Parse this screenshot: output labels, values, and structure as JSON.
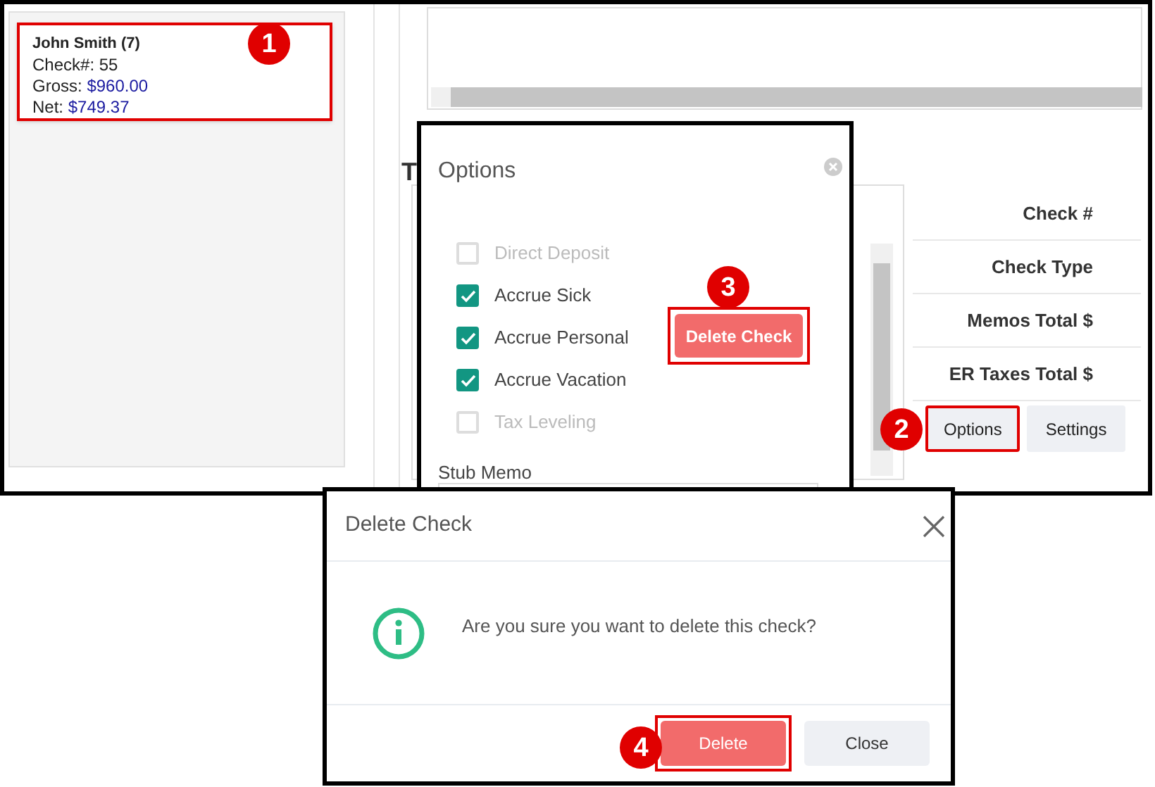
{
  "employee_card": {
    "name": "John Smith (7)",
    "check_no": "Check#: 55",
    "gross_label": "Gross:",
    "gross_value": "$960.00",
    "net_label": "Net:",
    "net_value": "$749.37",
    "highlighted": true,
    "callout": "1"
  },
  "section_heading": "T",
  "summary_labels": [
    "Check #",
    "Check Type",
    "Memos Total $",
    "ER Taxes Total $"
  ],
  "buttons": [
    {
      "label": "Options",
      "highlighted": true,
      "callout": "2"
    },
    {
      "label": "Settings",
      "highlighted": false
    }
  ],
  "options_popup": {
    "title": "Options",
    "checkboxes": [
      {
        "label": "Direct Deposit",
        "checked": false,
        "disabled": true
      },
      {
        "label": "Accrue Sick",
        "checked": true,
        "disabled": false
      },
      {
        "label": "Accrue Personal",
        "checked": true,
        "disabled": false
      },
      {
        "label": "Accrue Vacation",
        "checked": true,
        "disabled": false
      },
      {
        "label": "Tax Leveling",
        "checked": false,
        "disabled": true
      }
    ],
    "delete_button": {
      "label": "Delete Check",
      "highlighted": true,
      "callout": "3"
    },
    "stub_memo_label": "Stub Memo"
  },
  "delete_dialog": {
    "title": "Delete Check",
    "message": "Are you sure you want to delete this check?",
    "buttons": [
      {
        "label": "Delete",
        "kind": "danger",
        "highlighted": true,
        "callout": "4"
      },
      {
        "label": "Close",
        "kind": "secondary"
      }
    ]
  }
}
